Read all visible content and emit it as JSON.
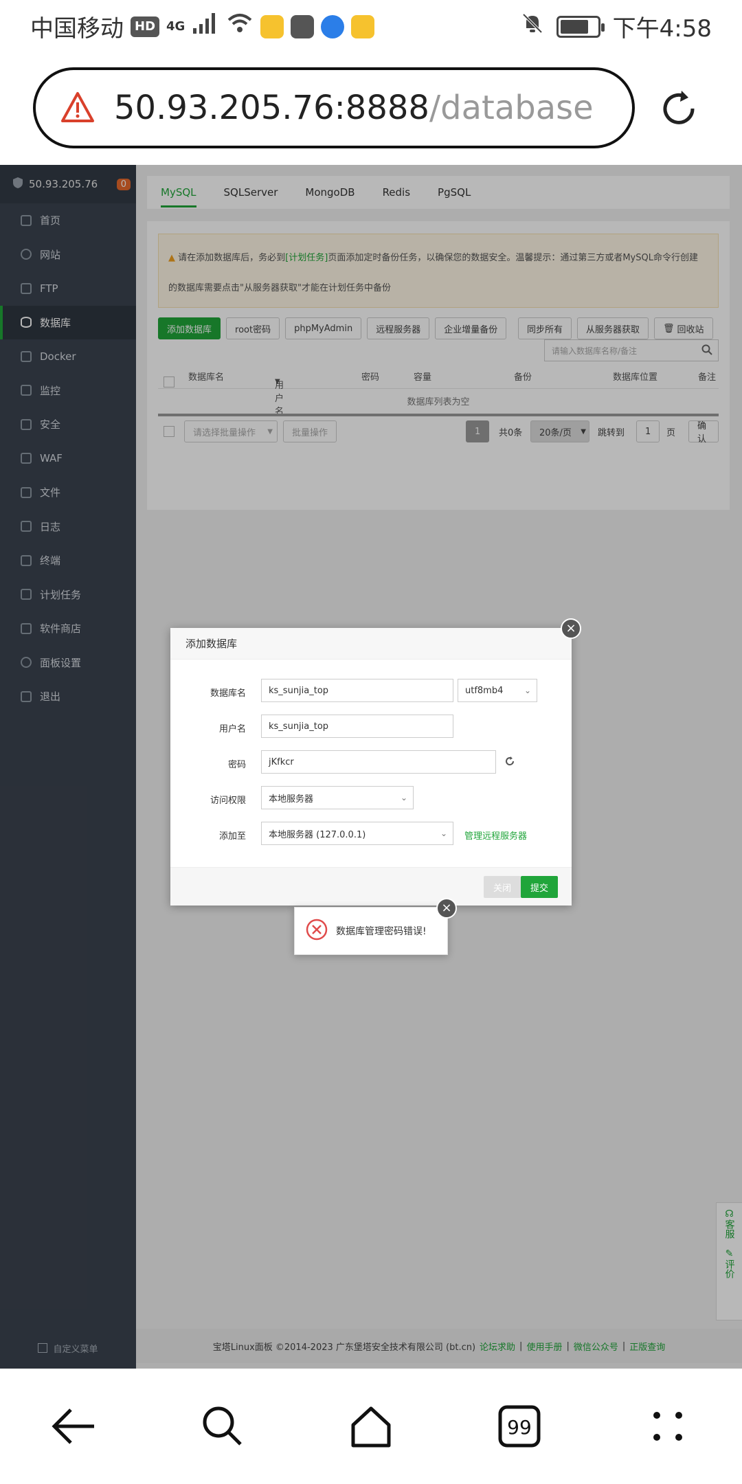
{
  "status_bar": {
    "carrier": "中国移动",
    "hd": "HD",
    "network": "4G",
    "time": "下午4:58"
  },
  "browser": {
    "url_host": "50.93.205.76:8888",
    "url_path": "/database"
  },
  "sidebar": {
    "server_ip": "50.93.205.76",
    "badge": "0",
    "items": [
      {
        "label": "首页"
      },
      {
        "label": "网站"
      },
      {
        "label": "FTP"
      },
      {
        "label": "数据库"
      },
      {
        "label": "Docker"
      },
      {
        "label": "监控"
      },
      {
        "label": "安全"
      },
      {
        "label": "WAF"
      },
      {
        "label": "文件"
      },
      {
        "label": "日志"
      },
      {
        "label": "终端"
      },
      {
        "label": "计划任务"
      },
      {
        "label": "软件商店"
      },
      {
        "label": "面板设置"
      },
      {
        "label": "退出"
      }
    ],
    "footer": "自定义菜单"
  },
  "tabs": [
    "MySQL",
    "SQLServer",
    "MongoDB",
    "Redis",
    "PgSQL"
  ],
  "notice": {
    "part1": "请在添加数据库后，务必到",
    "link": "[计划任务]",
    "part2": "页面添加定时备份任务，以确保您的数据安全。温馨提示：通过第三方或者MySQL命令行创建",
    "line2": "的数据库需要点击\"从服务器获取\"才能在计划任务中备份"
  },
  "buttons": {
    "add_db": "添加数据库",
    "root_pw": "root密码",
    "phpmyadmin": "phpMyAdmin",
    "remote": "远程服务器",
    "enterprise": "企业增量备份",
    "sync_all": "同步所有",
    "fetch": "从服务器获取",
    "recycle": "回收站"
  },
  "search_placeholder": "请输入数据库名称/备注",
  "table": {
    "headers": [
      "数据库名",
      "用户名",
      "密码",
      "容量",
      "备份",
      "数据库位置",
      "备注"
    ],
    "empty": "数据库列表为空"
  },
  "bottom": {
    "batch_select": "请选择批量操作",
    "batch_btn": "批量操作",
    "page": "1",
    "total": "共0条",
    "per_page": "20条/页",
    "jump": "跳转到",
    "jump_val": "1",
    "page_unit": "页",
    "confirm": "确认"
  },
  "footer": {
    "copyright": "宝塔Linux面板 ©2014-2023 广东堡塔安全技术有限公司 (bt.cn)",
    "links": [
      "论坛求助",
      "使用手册",
      "微信公众号",
      "正版查询"
    ]
  },
  "side_float": {
    "service": "客服",
    "review": "评价"
  },
  "dialog": {
    "title": "添加数据库",
    "db_name_label": "数据库名",
    "db_name": "ks_sunjia_top",
    "charset": "utf8mb4",
    "user_label": "用户名",
    "user": "ks_sunjia_top",
    "pw_label": "密码",
    "pw": "jKfkcr",
    "access_label": "访问权限",
    "access": "本地服务器",
    "add_to_label": "添加至",
    "add_to": "本地服务器 (127.0.0.1)",
    "remote_link": "管理远程服务器",
    "close_btn": "关闭",
    "submit_btn": "提交"
  },
  "toast": {
    "message": "数据库管理密码错误!"
  }
}
